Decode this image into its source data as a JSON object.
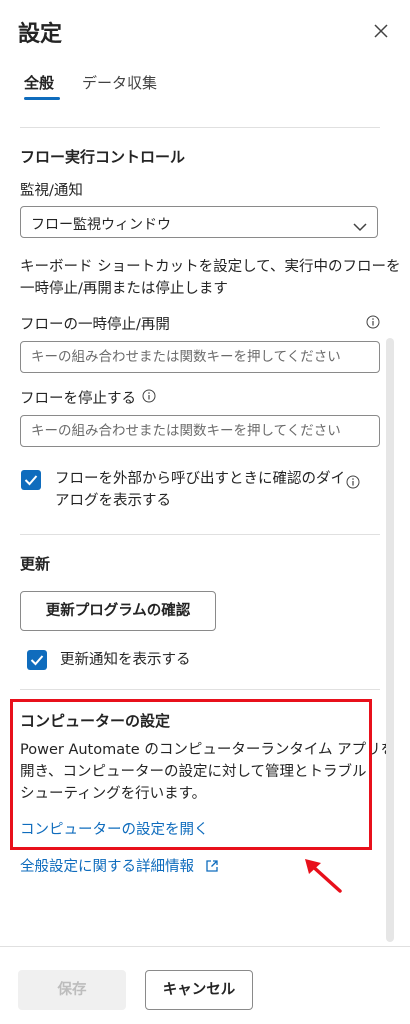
{
  "panel": {
    "title": "設定",
    "close_icon": "close-icon"
  },
  "tabs": [
    {
      "label": "全般",
      "active": true
    },
    {
      "label": "データ収集",
      "active": false
    }
  ],
  "flow_control": {
    "heading": "フロー実行コントロール",
    "monitor_label": "監視/通知",
    "monitor_value": "フロー監視ウィンドウ",
    "description_line1": "キーボード ショートカットを設定して、実行中のフローを",
    "description_line2": "一時停止/再開または停止します",
    "pause_label": "フローの一時停止/再開",
    "pause_placeholder": "キーの組み合わせまたは関数キーを押してください",
    "stop_label": "フローを停止する",
    "stop_placeholder": "キーの組み合わせまたは関数キーを押してください",
    "confirm_line1": "フローを外部から呼び出すときに確認のダイ",
    "confirm_line2": "アログを表示する",
    "confirm_checked": true
  },
  "update": {
    "heading": "更新",
    "check_button": "更新プログラムの確認",
    "notify_label": "更新通知を表示する",
    "notify_checked": true
  },
  "computer_settings": {
    "heading": "コンピューターの設定",
    "desc_line1": "Power Automate のコンピューターランタイム アプリを",
    "desc_line2": "開き、コンピューターの設定に対して管理とトラブル",
    "desc_line3": "シューティングを行います。",
    "open_link": "コンピューターの設定を開く"
  },
  "more_info_link": "全般設定に関する詳細情報",
  "footer": {
    "save_label": "保存",
    "cancel_label": "キャンセル"
  },
  "colors": {
    "accent": "#0f6cbd",
    "highlight": "#e8101b"
  }
}
